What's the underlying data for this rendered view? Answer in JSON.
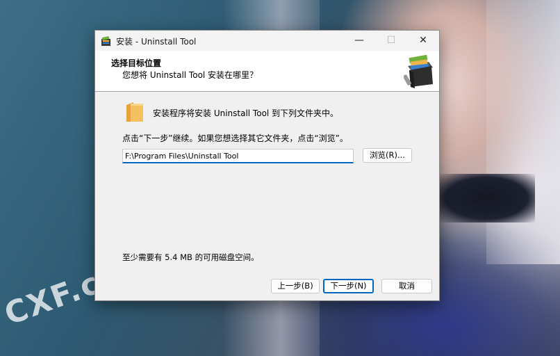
{
  "window": {
    "title": "安装 - Uninstall Tool",
    "controls": {
      "minimize": "—",
      "maximize": "☐",
      "close": "✕"
    }
  },
  "header": {
    "title": "选择目标位置",
    "subtitle": "您想将 Uninstall Tool 安装在哪里？",
    "icon": "installer-boxes-icon"
  },
  "body": {
    "description": "安装程序将安装 Uninstall Tool 到下列文件夹中。",
    "hint": "点击“下一步”继续。如果您想选择其它文件夹，点击“浏览”。",
    "path_value": "F:\\Program Files\\Uninstall Tool",
    "browse_label": "浏览(R)...",
    "space_required": "至少需要有 5.4 MB 的可用磁盘空间。"
  },
  "footer": {
    "back_label": "上一步(B)",
    "next_label": "下一步(N)",
    "cancel_label": "取消"
  },
  "background": {
    "watermark": "CXF.co"
  },
  "colors": {
    "accent": "#0067c0",
    "window_bg": "#f0f0f0",
    "header_bg": "#ffffff",
    "folder": "#f0b54a"
  }
}
